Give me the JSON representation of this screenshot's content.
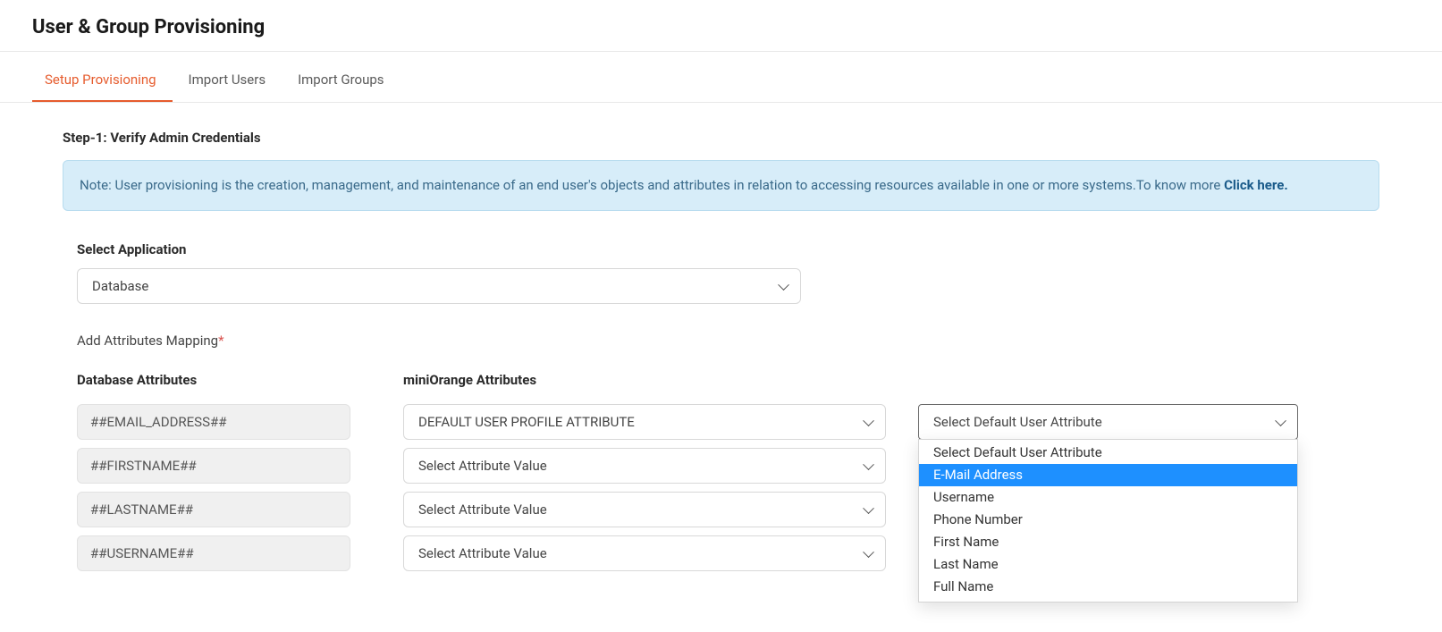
{
  "header": {
    "title": "User & Group Provisioning"
  },
  "tabs": [
    {
      "label": "Setup Provisioning",
      "active": true
    },
    {
      "label": "Import Users",
      "active": false
    },
    {
      "label": "Import Groups",
      "active": false
    }
  ],
  "step": {
    "title": "Step-1: Verify Admin Credentials"
  },
  "note": {
    "text": "Note: User provisioning is the creation, management, and maintenance of an end user's objects and attributes in relation to accessing resources available in one or more systems.To know more ",
    "link": "Click here."
  },
  "app_select": {
    "label": "Select Application",
    "value": "Database"
  },
  "mapping_label": "Add Attributes Mapping",
  "columns": {
    "db_header": "Database Attributes",
    "mo_header": "miniOrange Attributes"
  },
  "rows": [
    {
      "db": "##EMAIL_ADDRESS##",
      "mo": "DEFAULT USER PROFILE ATTRIBUTE"
    },
    {
      "db": "##FIRSTNAME##",
      "mo": "Select Attribute Value"
    },
    {
      "db": "##LASTNAME##",
      "mo": "Select Attribute Value"
    },
    {
      "db": "##USERNAME##",
      "mo": "Select Attribute Value"
    }
  ],
  "default_select": {
    "value": "Select Default User Attribute",
    "options": [
      "Select Default User Attribute",
      "E-Mail Address",
      "Username",
      "Phone Number",
      "First Name",
      "Last Name",
      "Full Name"
    ],
    "highlighted": "E-Mail Address"
  }
}
